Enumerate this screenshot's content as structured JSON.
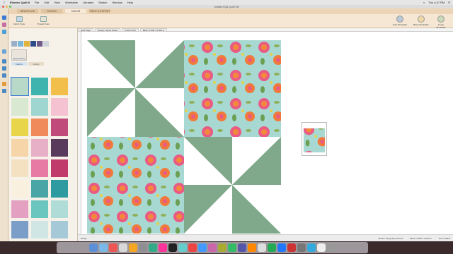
{
  "menubar": {
    "app_name": "Electric Quilt 8",
    "items": [
      "File",
      "Edit",
      "View",
      "Worktable",
      "Libraries",
      "Sketch",
      "Window",
      "Help"
    ],
    "clock": "Thu 4:47 PM"
  },
  "window": {
    "title": "Untitled EQ8 Quilt.PJ8"
  },
  "tabs": [
    "NEW/PLACE",
    "DESIGN",
    "COLOR",
    "PRINT & EXPORT"
  ],
  "toolbar": {
    "tools": [
      "Fabric Tools",
      "Thread Tools"
    ],
    "worktables": [
      "Quilt Worktable",
      "Block Worktable",
      "Image Worktable"
    ]
  },
  "fabric_panel": {
    "spray_label": "Spray Plenty",
    "tabs": [
      "Fabrics",
      "Library"
    ]
  },
  "canvas": {
    "info_tabs": [
      "Quilt Page",
      "Design Layout Name",
      "Custom Set",
      "Block: 6.000 x 6.000 in"
    ]
  },
  "statusbar": {
    "left": "Ready",
    "items": [
      "Mouse: Drag-drop Fabrics",
      "Block: 6.000 x 6.000 in",
      "Zoom 100%"
    ]
  },
  "colors": {
    "green": "#7fa98a",
    "white": "#ffffff",
    "floral_bg": "#a8d8d2",
    "toolbar_bg": "#f5e7d4",
    "tab_band": "#ecd4b6"
  }
}
